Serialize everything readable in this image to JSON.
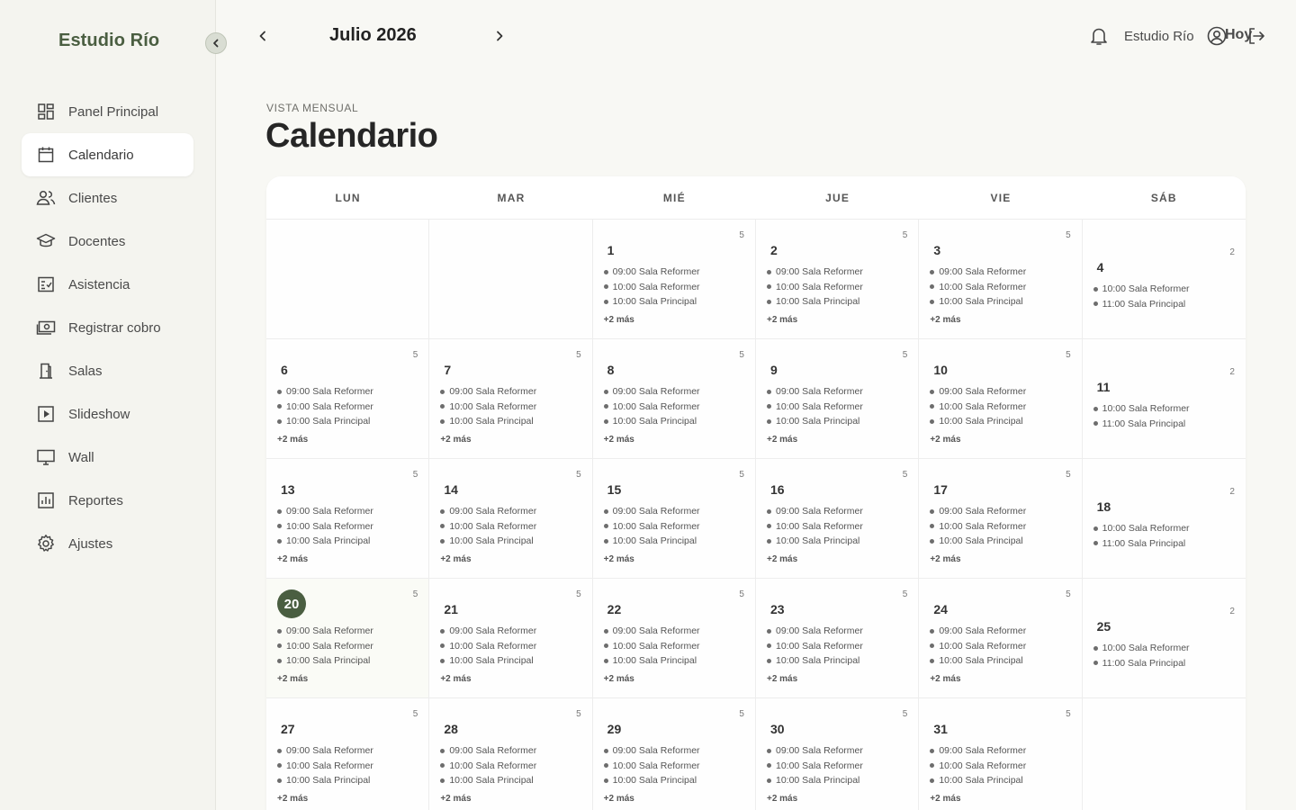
{
  "sidebar": {
    "brand": "Estudio Río",
    "items": [
      {
        "label": "Panel Principal",
        "icon": "dashboard-icon",
        "active": false
      },
      {
        "label": "Calendario",
        "icon": "calendar-icon",
        "active": true
      },
      {
        "label": "Clientes",
        "icon": "users-icon",
        "active": false
      },
      {
        "label": "Docentes",
        "icon": "graduation-cap-icon",
        "active": false
      },
      {
        "label": "Asistencia",
        "icon": "checklist-icon",
        "active": false
      },
      {
        "label": "Registrar cobro",
        "icon": "cash-icon",
        "active": false
      },
      {
        "label": "Salas",
        "icon": "door-icon",
        "active": false
      },
      {
        "label": "Slideshow",
        "icon": "play-icon",
        "active": false
      },
      {
        "label": "Wall",
        "icon": "monitor-icon",
        "active": false
      },
      {
        "label": "Reportes",
        "icon": "bar-chart-icon",
        "active": false
      },
      {
        "label": "Ajustes",
        "icon": "gear-icon",
        "active": false
      }
    ]
  },
  "topbar": {
    "month": "Julio 2026",
    "studio": "Estudio Río",
    "today_label": "Hoy"
  },
  "header": {
    "eyebrow": "VISTA MENSUAL",
    "title": "Calendario"
  },
  "calendar": {
    "weekdays": [
      "LUN",
      "MAR",
      "MIÉ",
      "JUE",
      "VIE",
      "SÁB"
    ],
    "today": 20,
    "more_label": "+2 más",
    "weekday_events": [
      "09:00 Sala Reformer",
      "10:00 Sala Reformer",
      "10:00 Sala Principal"
    ],
    "weekday_count": "5",
    "saturday_events": [
      "10:00 Sala Reformer",
      "11:00 Sala Principal"
    ],
    "saturday_count": "2",
    "weeks": [
      [
        null,
        null,
        1,
        2,
        3,
        4
      ],
      [
        6,
        7,
        8,
        9,
        10,
        11
      ],
      [
        13,
        14,
        15,
        16,
        17,
        18
      ],
      [
        20,
        21,
        22,
        23,
        24,
        25
      ],
      [
        27,
        28,
        29,
        30,
        31,
        null
      ]
    ]
  },
  "colors": {
    "accent": "#4a5e41",
    "background": "#f8f8f4",
    "sidebar": "#f4f4ef"
  }
}
